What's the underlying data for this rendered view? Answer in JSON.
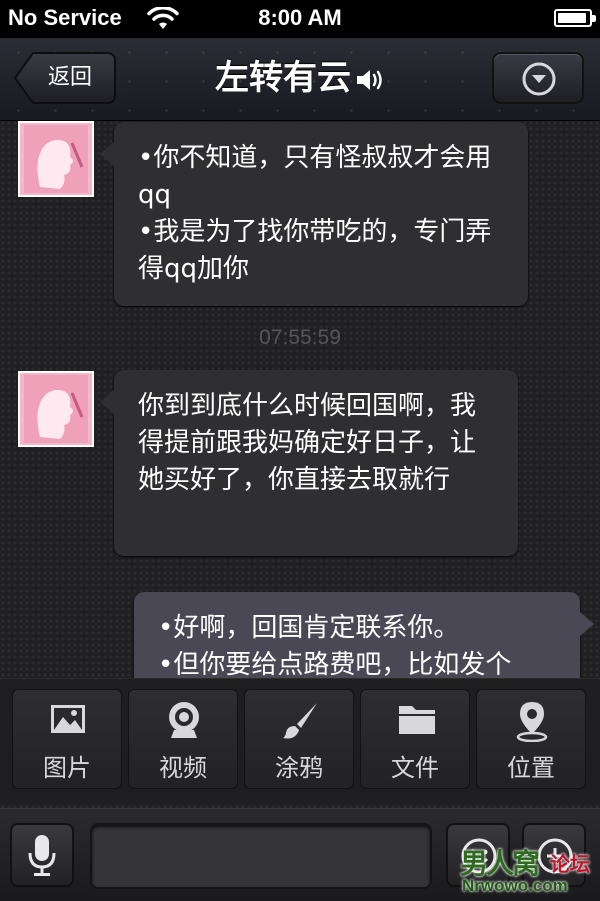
{
  "status_bar": {
    "carrier": "No Service",
    "time": "8:00 AM"
  },
  "nav": {
    "back_label": "返回",
    "title": "左转有云"
  },
  "messages": [
    {
      "direction": "incoming",
      "lines": [
        "•你不知道，只有怪叔叔才会用qq",
        "•我是为了找你带吃的，专门弄得qq加你"
      ]
    },
    {
      "timestamp": "07:55:59"
    },
    {
      "direction": "incoming",
      "lines": [
        "你到到底什么时候回国啊，我得提前跟我妈确定好日子，让她买好了，你直接去取就行"
      ]
    },
    {
      "direction": "outgoing",
      "lines": [
        "•好啊，回国肯定联系你。",
        "•但你要给点路费吧，比如发个"
      ]
    }
  ],
  "toolbar": {
    "items": [
      {
        "label": "图片",
        "icon": "image-icon"
      },
      {
        "label": "视频",
        "icon": "webcam-icon"
      },
      {
        "label": "涂鸦",
        "icon": "brush-icon"
      },
      {
        "label": "文件",
        "icon": "folder-icon"
      },
      {
        "label": "位置",
        "icon": "location-pin-icon"
      }
    ]
  },
  "input_bar": {
    "mic_icon": "microphone-icon",
    "text_value": "",
    "emoji_icon": "emoji-icon",
    "plus_icon": "plus-icon"
  },
  "watermark": {
    "line1": "男人窝",
    "line1b": "论坛",
    "line2": "Nrwowo.com"
  },
  "colors": {
    "bubble_in": "#2f2f31",
    "bubble_out": "#4a4855",
    "background": "#202022"
  }
}
